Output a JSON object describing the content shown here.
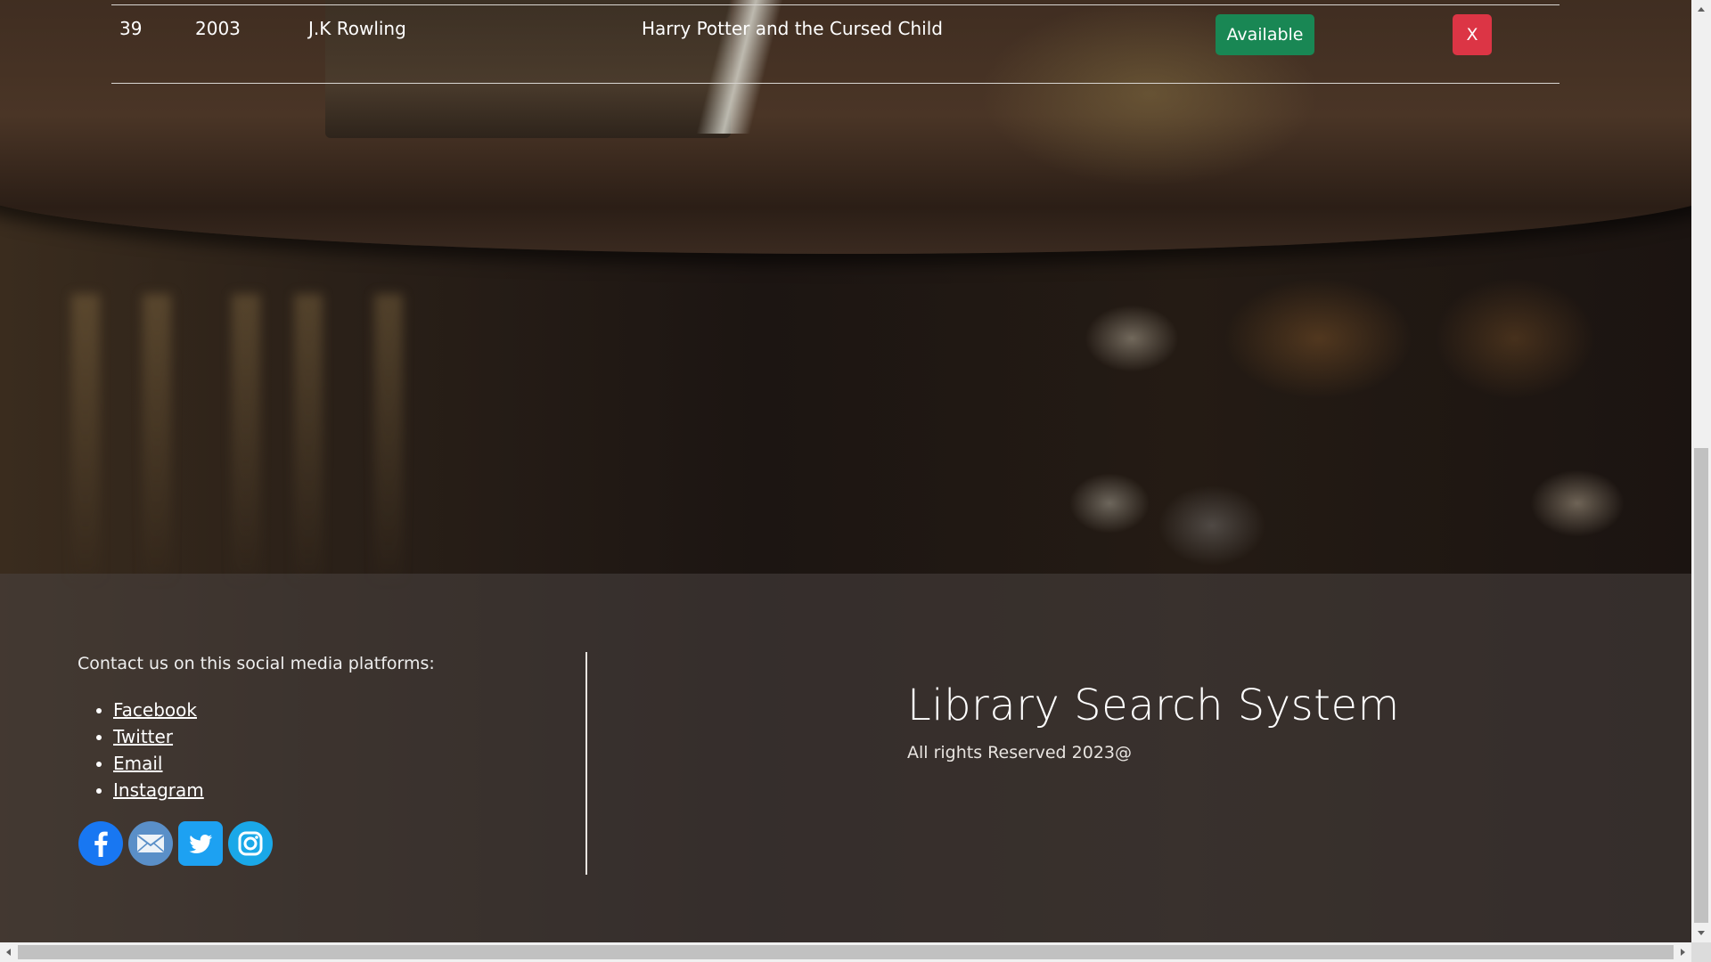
{
  "row": {
    "id": "39",
    "year": "2003",
    "author": "J.K Rowling",
    "title": "Harry Potter and the Cursed Child",
    "status_label": "Available",
    "delete_label": "X"
  },
  "footer": {
    "contact_title": "Contact us on this social media platforms:",
    "links": [
      "Facebook",
      "Twitter",
      "Email",
      "Instagram"
    ],
    "icons": [
      "facebook-icon",
      "email-icon",
      "twitter-icon",
      "instagram-icon"
    ],
    "site_title": "Library Search System",
    "rights": "All rights Reserved 2023@"
  },
  "colors": {
    "available": "#198754",
    "delete": "#dc3545",
    "facebook": "#1877f2",
    "twitter": "#1da1f2",
    "instagram": "#1aa8e8"
  }
}
